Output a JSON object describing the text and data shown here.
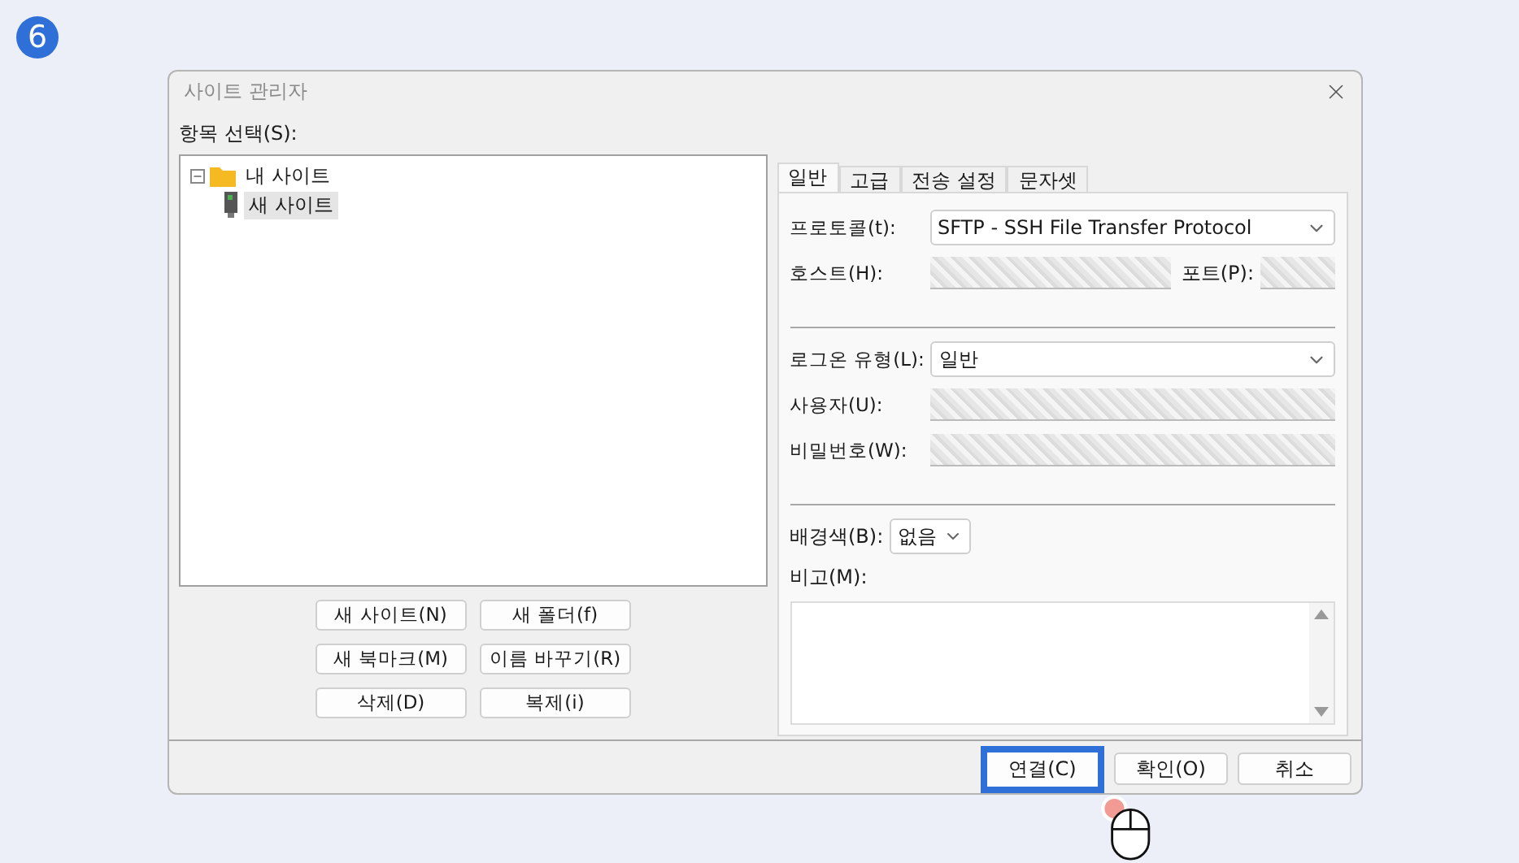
{
  "step_badge": "6",
  "dialog": {
    "title": "사이트 관리자"
  },
  "site_list": {
    "label": "항목 선택(S):",
    "tree": [
      {
        "label": "내 사이트",
        "kind": "folder",
        "expanded": true,
        "selected": false,
        "children": [
          {
            "label": "새 사이트",
            "kind": "site",
            "selected": true
          }
        ]
      }
    ],
    "buttons": [
      "새 사이트(N)",
      "새 폴더(f)",
      "새 북마크(M)",
      "이름 바꾸기(R)",
      "삭제(D)",
      "복제(i)"
    ]
  },
  "tabs": [
    {
      "label": "일반",
      "selected": true
    },
    {
      "label": "고급",
      "selected": false
    },
    {
      "label": "전송 설정",
      "selected": false
    },
    {
      "label": "문자셋",
      "selected": false
    }
  ],
  "general": {
    "protocol": {
      "label": "프로토콜(t):",
      "value": "SFTP - SSH File Transfer Protocol"
    },
    "host": {
      "label": "호스트(H):"
    },
    "port": {
      "label": "포트(P):"
    },
    "logon_type": {
      "label": "로그온 유형(L):",
      "value": "일반"
    },
    "user": {
      "label": "사용자(U):"
    },
    "password": {
      "label": "비밀번호(W):"
    },
    "background_color": {
      "label": "배경색(B):",
      "value": "없음"
    },
    "comments": {
      "label": "비고(M):"
    }
  },
  "footer_buttons": [
    {
      "label": "연결(C)",
      "highlighted": true
    },
    {
      "label": "확인(O)",
      "highlighted": false
    },
    {
      "label": "취소",
      "highlighted": false
    }
  ]
}
